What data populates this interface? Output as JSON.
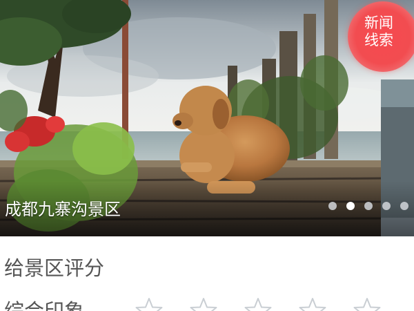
{
  "carousel": {
    "slide_title": "成都九寨沟景区",
    "slide_count": 5,
    "active_slide_index": 1
  },
  "news_tip": {
    "label": "新闻线索",
    "color": "#f24c50"
  },
  "rating": {
    "heading": "给景区评分",
    "overall_label": "综合印象",
    "max_stars": 5,
    "selected_stars": 0,
    "star_outline_color": "#c9ced3"
  }
}
